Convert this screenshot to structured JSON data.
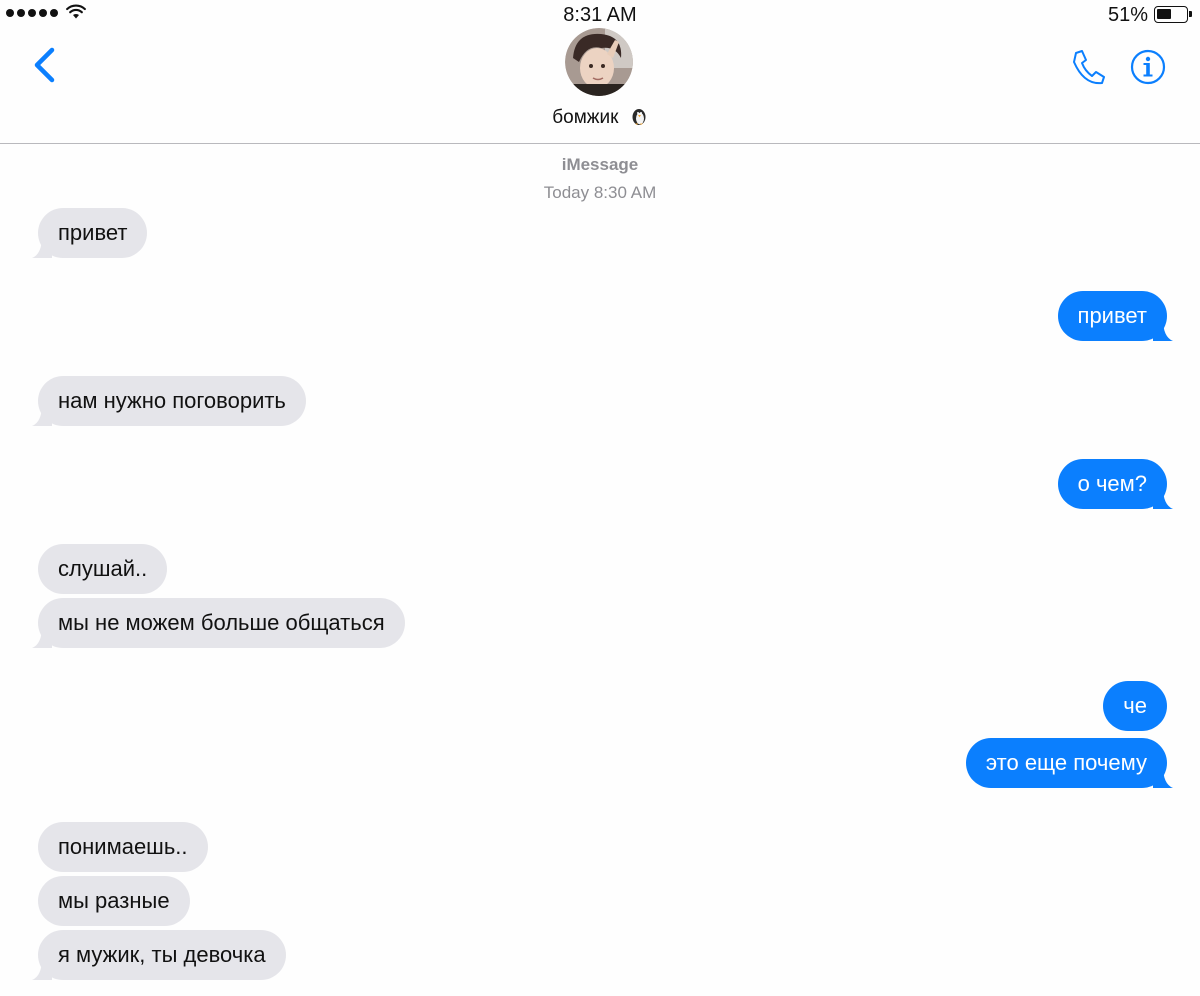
{
  "status_bar": {
    "time": "8:31 AM",
    "battery_percent": "51%",
    "battery_level": 0.51,
    "signal_dots": 5,
    "icons": [
      "signal-dots-icon",
      "wifi-icon",
      "battery-icon"
    ]
  },
  "header": {
    "contact_name": "бомжик",
    "contact_emoji": "penguin-icon",
    "buttons": [
      "back-chevron-icon",
      "phone-icon",
      "info-icon"
    ],
    "accent_color": "#0b7ffe"
  },
  "thread": {
    "service": "iMessage",
    "timestamp": "Today 8:30 AM"
  },
  "messages": [
    {
      "dir": "in",
      "text": "привет"
    },
    {
      "dir": "out",
      "text": "привет"
    },
    {
      "dir": "in",
      "text": "нам нужно поговорить"
    },
    {
      "dir": "out",
      "text": "о чем?"
    },
    {
      "dir": "in",
      "text": "слушай.."
    },
    {
      "dir": "in",
      "text": "мы не можем больше общаться"
    },
    {
      "dir": "out",
      "text": "че"
    },
    {
      "dir": "out",
      "text": "это еще почему"
    },
    {
      "dir": "in",
      "text": "понимаешь.."
    },
    {
      "dir": "in",
      "text": "мы разные"
    },
    {
      "dir": "in",
      "text": "я мужик, ты девочка"
    }
  ],
  "colors": {
    "incoming_bubble": "#e5e5ea",
    "outgoing_bubble": "#0b7ffe",
    "meta_text": "#8e8e93"
  }
}
